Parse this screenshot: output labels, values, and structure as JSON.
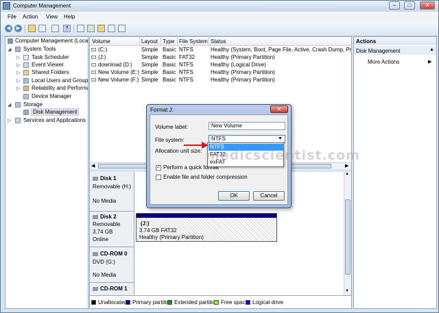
{
  "window": {
    "title": "Computer Management",
    "minimize": "–",
    "maximize": "□",
    "close": "✕"
  },
  "menu": [
    "File",
    "Action",
    "View",
    "Help"
  ],
  "tree": {
    "root": "Computer Management (Local",
    "system_tools": "System Tools",
    "task_scheduler": "Task Scheduler",
    "event_viewer": "Event Viewer",
    "shared_folders": "Shared Folders",
    "local_users": "Local Users and Groups",
    "reliability": "Reliability and Performa",
    "device_manager": "Device Manager",
    "storage": "Storage",
    "disk_management": "Disk Management",
    "services": "Services and Applications"
  },
  "volumes": {
    "headers": [
      "Volume",
      "Layout",
      "Type",
      "File System",
      "Status"
    ],
    "rows": [
      [
        "(C:)",
        "Simple",
        "Basic",
        "NTFS",
        "Healthy (System, Boot, Page File, Active, Crash Dump, Prima"
      ],
      [
        "(J:)",
        "Simple",
        "Basic",
        "FAT32",
        "Healthy (Primary Partition)"
      ],
      [
        "download (D:)",
        "Simple",
        "Basic",
        "NTFS",
        "Healthy (Logical Drive)"
      ],
      [
        "New Volume (E:)",
        "Simple",
        "Basic",
        "NTFS",
        "Healthy (Primary Partition)"
      ],
      [
        "New Volume (F:)",
        "Simple",
        "Basic",
        "NTFS",
        "Healthy (Primary Partition)"
      ]
    ]
  },
  "disks": [
    {
      "name": "Disk 1",
      "type": "Removable (H:)",
      "status": "No Media"
    },
    {
      "name": "Disk 2",
      "type": "Removable",
      "size": "3.74 GB",
      "status": "Online",
      "partition": {
        "label": "(J:)",
        "size": "3.74 GB FAT32",
        "health": "Healthy (Primary Partition)"
      }
    },
    {
      "name": "CD-ROM 0",
      "type": "DVD (G:)",
      "status": "No Media"
    },
    {
      "name": "CD-ROM 1"
    }
  ],
  "legend": [
    {
      "label": "Unallocated",
      "color": "#000000"
    },
    {
      "label": "Primary partition",
      "color": "#000080"
    },
    {
      "label": "Extended partition",
      "color": "#00a000"
    },
    {
      "label": "Free space",
      "color": "#80ff00"
    },
    {
      "label": "Logical drive",
      "color": "#0000ff"
    }
  ],
  "actions": {
    "header": "Actions",
    "section": "Disk Management",
    "more": "More Actions"
  },
  "dialog": {
    "title": "Format J:",
    "close": "✕",
    "volume_label_caption": "Volume label:",
    "volume_label_value": "New Volume",
    "file_system_caption": "File system:",
    "file_system_value": "NTFS",
    "allocation_caption": "Allocation unit size:",
    "options": [
      "NTFS",
      "FAT32",
      "exFAT"
    ],
    "quick_format": "Perform a quick format",
    "quick_format_checked": true,
    "compression": "Enable file and folder compression",
    "compression_checked": false,
    "ok": "OK",
    "cancel": "Cancel"
  },
  "watermark": "medicscientist.com"
}
